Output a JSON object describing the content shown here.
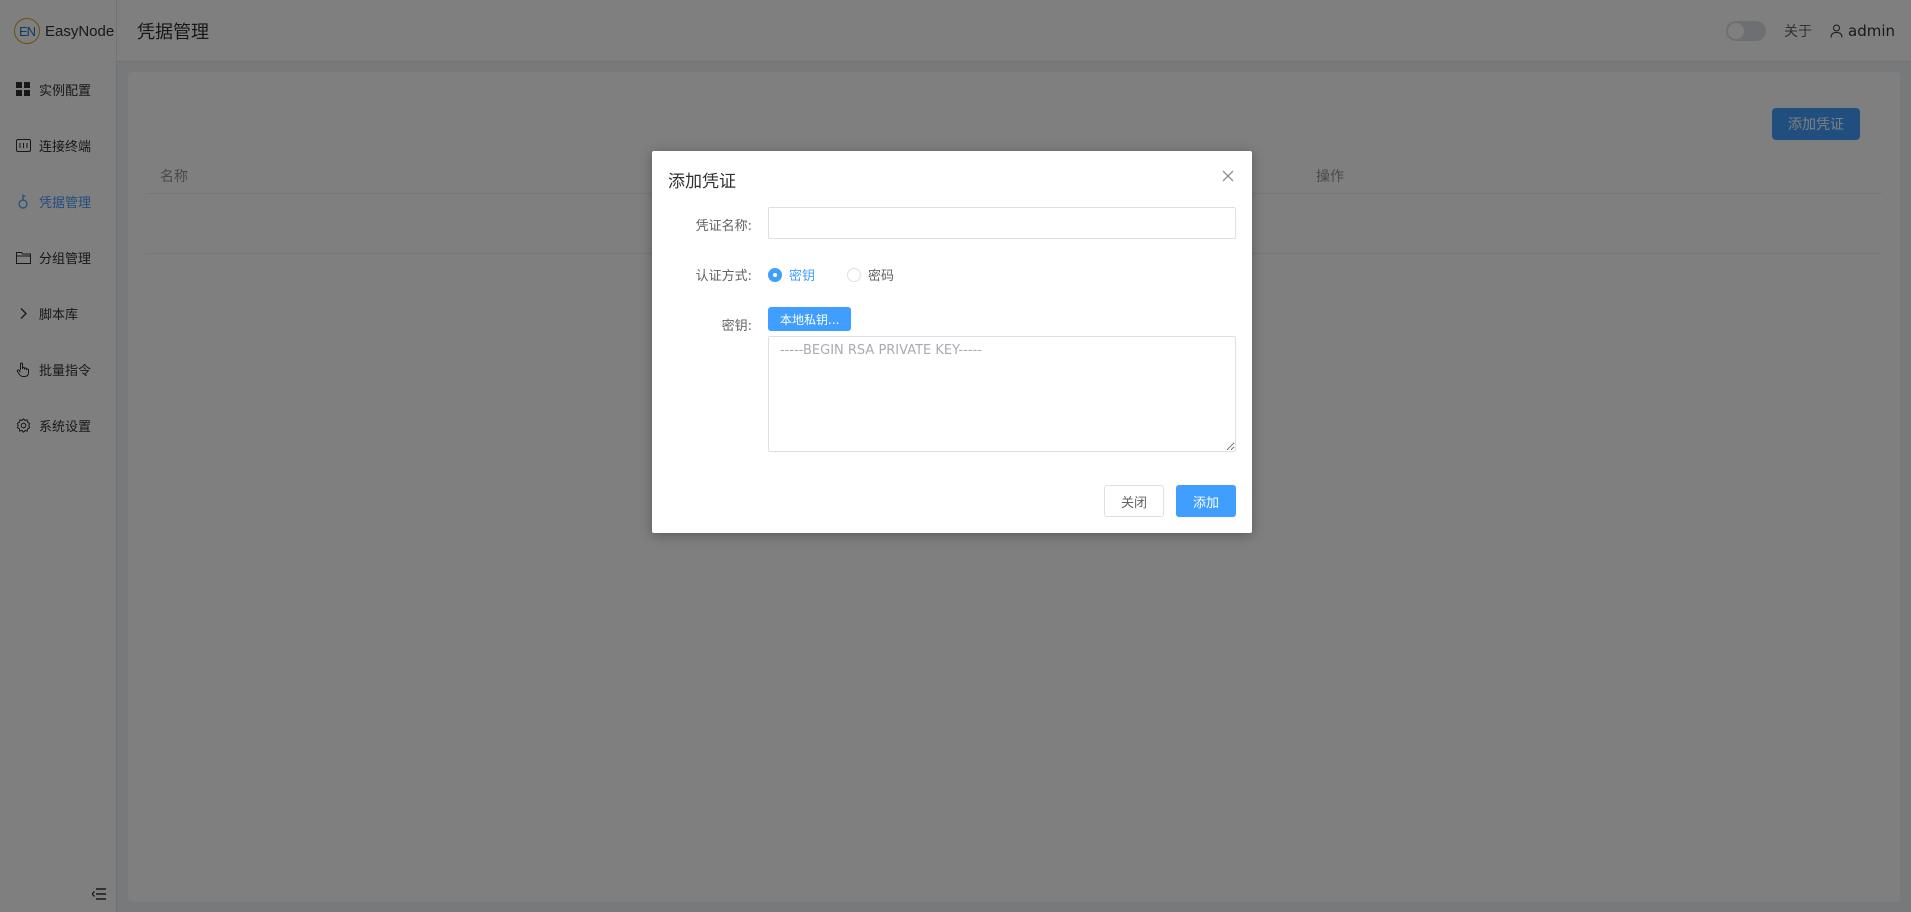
{
  "app": {
    "logo_mark": "EN",
    "logo_text": "EasyNode",
    "page_title": "凭据管理"
  },
  "sidebar": {
    "items": [
      {
        "label": "实例配置",
        "icon": "grid-icon",
        "active": false
      },
      {
        "label": "连接终端",
        "icon": "terminal-icon",
        "active": false
      },
      {
        "label": "凭据管理",
        "icon": "key-icon",
        "active": true
      },
      {
        "label": "分组管理",
        "icon": "folder-icon",
        "active": false
      },
      {
        "label": "脚本库",
        "icon": "chevron-right-icon",
        "active": false
      },
      {
        "label": "批量指令",
        "icon": "pointer-icon",
        "active": false
      },
      {
        "label": "系统设置",
        "icon": "gear-icon",
        "active": false
      }
    ],
    "collapse_icon": "menu-fold-icon"
  },
  "header": {
    "about_label": "关于",
    "user_name": "admin"
  },
  "main": {
    "add_button_label": "添加凭证",
    "table": {
      "columns": [
        "名称",
        "操作"
      ]
    }
  },
  "dialog": {
    "title": "添加凭证",
    "name_label": "凭证名称:",
    "name_value": "",
    "auth_label": "认证方式:",
    "auth_options": [
      {
        "label": "密钥",
        "checked": true
      },
      {
        "label": "密码",
        "checked": false
      }
    ],
    "key_label": "密钥:",
    "local_key_button": "本地私钥...",
    "key_placeholder": "-----BEGIN RSA PRIVATE KEY-----",
    "close_button": "关闭",
    "add_button": "添加"
  },
  "colors": {
    "primary": "#409eff",
    "overlay": "rgba(0,0,0,0.5)"
  }
}
